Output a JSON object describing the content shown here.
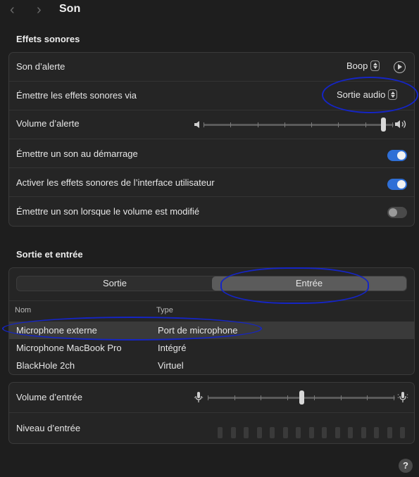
{
  "header": {
    "title": "Son",
    "back_icon": "chevron-left-icon",
    "forward_icon": "chevron-right-icon"
  },
  "sound_effects": {
    "section_title": "Effets sonores",
    "alert_sound": {
      "label": "Son d’alerte",
      "value": "Boop"
    },
    "output_via": {
      "label": "Émettre les effets sonores via",
      "value": "Sortie audio"
    },
    "alert_volume": {
      "label": "Volume d’alerte",
      "level": 0.96,
      "ticks": 8
    },
    "startup_sound": {
      "label": "Émettre un son au démarrage",
      "on": true
    },
    "ui_sound_effects": {
      "label": "Activer les effets sonores de l’interface utilisateur",
      "on": true
    },
    "volume_change_sound": {
      "label": "Émettre un son lorsque le volume est modifié",
      "on": false
    }
  },
  "output_input": {
    "section_title": "Sortie et entrée",
    "tabs": [
      {
        "label": "Sortie",
        "active": false
      },
      {
        "label": "Entrée",
        "active": true
      }
    ],
    "columns": {
      "name": "Nom",
      "type": "Type"
    },
    "devices": [
      {
        "name": "Microphone externe",
        "type": "Port de microphone",
        "selected": true
      },
      {
        "name": "Microphone MacBook Pro",
        "type": "Intégré",
        "selected": false
      },
      {
        "name": "BlackHole 2ch",
        "type": "Virtuel",
        "selected": false
      }
    ]
  },
  "input_controls": {
    "input_volume": {
      "label": "Volume d’entrée",
      "level": 0.5,
      "ticks": 8
    },
    "input_level": {
      "label": "Niveau d’entrée",
      "bars": 15,
      "level": 0
    }
  },
  "help": {
    "label": "?"
  },
  "colors": {
    "accent": "#2f6fd6",
    "annotation": "#1525c4",
    "background": "#1e1e1e"
  }
}
